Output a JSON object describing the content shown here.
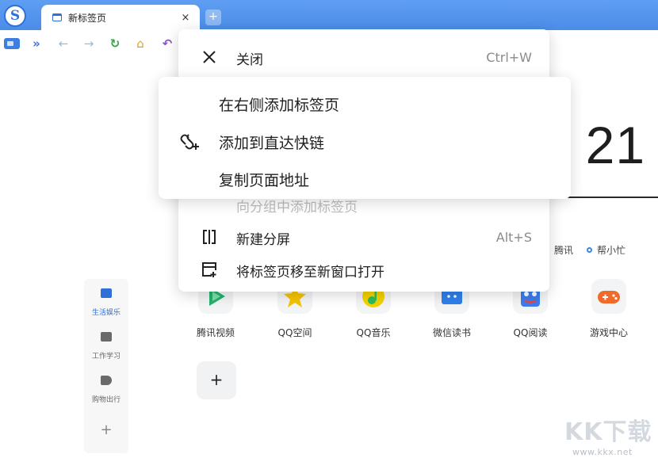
{
  "tabs": [
    {
      "title": "新标签页"
    }
  ],
  "tab_close_glyph": "×",
  "new_tab_glyph": "+",
  "toolbar": {
    "icons": [
      "sidebar-icon",
      "expand-icon",
      "back-icon",
      "forward-icon",
      "reload-icon",
      "home-icon",
      "undo-icon"
    ]
  },
  "page": {
    "clock_text": ": 21",
    "quick_links": [
      "腾讯",
      "帮小忙"
    ],
    "categories": [
      {
        "label": "生活娱乐",
        "icon": "book-icon",
        "color": "#2f6fd8",
        "active": true
      },
      {
        "label": "工作学习",
        "icon": "briefcase-icon",
        "color": "#6a6a6a",
        "active": false
      },
      {
        "label": "购物出行",
        "icon": "tag-icon",
        "color": "#6a6a6a",
        "active": false
      }
    ],
    "category_add": "+",
    "apps": [
      {
        "label": "腾讯视频",
        "icon": "tencent-video-icon",
        "color": "#23b26d"
      },
      {
        "label": "QQ空间",
        "icon": "qzone-icon",
        "color": "#f5c400"
      },
      {
        "label": "QQ音乐",
        "icon": "qq-music-icon",
        "color": "#2ebd59"
      },
      {
        "label": "微信读书",
        "icon": "wechat-read-icon",
        "color": "#2f80ed"
      },
      {
        "label": "QQ阅读",
        "icon": "qq-read-icon",
        "color": "#3b7ef0"
      },
      {
        "label": "游戏中心",
        "icon": "game-center-icon",
        "color": "#f06a2a"
      }
    ],
    "add_app": "+"
  },
  "context_menu": {
    "close": {
      "label": "关闭",
      "shortcut": "Ctrl+W"
    },
    "add_to_group": {
      "label": "向分组中添加标签页"
    },
    "split_screen": {
      "label": "新建分屏",
      "shortcut": "Alt+S"
    },
    "move_window": {
      "label": "将标签页移至新窗口打开"
    }
  },
  "submenu": {
    "add_right": {
      "label": "在右侧添加标签页"
    },
    "add_quicklink": {
      "label": "添加到直达快链"
    },
    "copy_address": {
      "label": "复制页面地址"
    }
  },
  "watermark": {
    "logo": "KK下载",
    "url": "www.kkx.net"
  }
}
